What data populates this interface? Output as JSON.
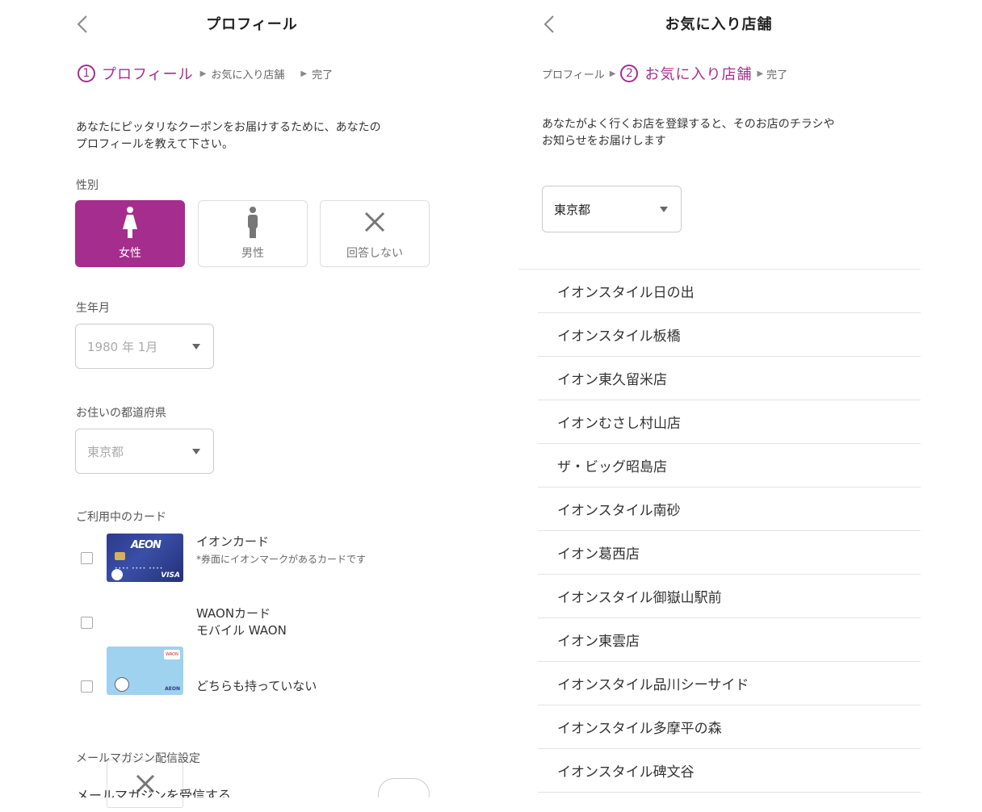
{
  "left": {
    "header": {
      "title": "プロフィール"
    },
    "steps": {
      "num": "1",
      "active": "プロフィール",
      "step2": "お気に入り店舗",
      "step3": "完了"
    },
    "intro": {
      "line1": "あなたにピッタリなクーポンをお届けするために、あなたの",
      "line2": "プロフィールを教えて下さい。"
    },
    "gender": {
      "label": "性別",
      "options": [
        {
          "label": "女性",
          "selected": true
        },
        {
          "label": "男性",
          "selected": false
        },
        {
          "label": "回答しない",
          "selected": false
        }
      ]
    },
    "birth": {
      "label": "生年月",
      "value": "1980 年 1月"
    },
    "prefecture": {
      "label": "お住いの都道府県",
      "value": "東京都"
    },
    "cards": {
      "label": "ご利用中のカード",
      "aeon": {
        "name": "イオンカード",
        "note": "*券面にイオンマークがあるカードです",
        "logo": "AEON",
        "brand": "VISA"
      },
      "waon": {
        "name_line1": "WAONカード",
        "name_line2": "モバイル WAON",
        "logo": "WAON",
        "brand": "AEON"
      },
      "none": {
        "name": "どちらも持っていない"
      }
    },
    "mail": {
      "label": "メールマガジン配信設定",
      "toggle_label": "メールマガジンを受信する"
    }
  },
  "right": {
    "header": {
      "title": "お気に入り店舗"
    },
    "steps": {
      "step1": "プロフィール",
      "num": "2",
      "active": "お気に入り店舗",
      "step3": "完了"
    },
    "intro": {
      "line1": "あなたがよく行くお店を登録すると、そのお店のチラシや",
      "line2": "お知らせをお届けします"
    },
    "prefecture": {
      "value": "東京都"
    },
    "stores": [
      "イオンスタイル日の出",
      "イオンスタイル板橋",
      "イオン東久留米店",
      "イオンむさし村山店",
      "ザ・ビッグ昭島店",
      "イオンスタイル南砂",
      "イオン葛西店",
      "イオンスタイル御嶽山駅前",
      "イオン東雲店",
      "イオンスタイル品川シーサイド",
      "イオンスタイル多摩平の森",
      "イオンスタイル碑文谷"
    ]
  },
  "colors": {
    "accent": "#a52d8e",
    "border": "#dddddd",
    "text": "#333333"
  }
}
